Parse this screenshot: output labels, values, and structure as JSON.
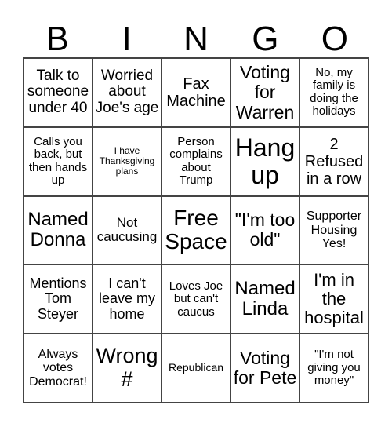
{
  "header": [
    "B",
    "I",
    "N",
    "G",
    "O"
  ],
  "cells": [
    "Talk to someone under 40",
    "Worried about Joe's age",
    "Fax Machine",
    "Voting for Warren",
    "No, my family is doing the holidays",
    "Calls you back, but then hands up",
    "I have Thanksgiving plans",
    "Person complains about Trump",
    "Hang up",
    "2 Refused in a row",
    "Named Donna",
    "Not caucusing",
    "Free Space",
    "\"I'm too old\"",
    "Supporter Housing Yes!",
    "Mentions Tom Steyer",
    "I can't leave my home",
    "Loves Joe but can't caucus",
    "Named Linda",
    "I'm in the hospital",
    "Always votes Democrat!",
    "Wrong #",
    "Republican",
    "Voting for Pete",
    "\"I'm not giving you money\""
  ]
}
